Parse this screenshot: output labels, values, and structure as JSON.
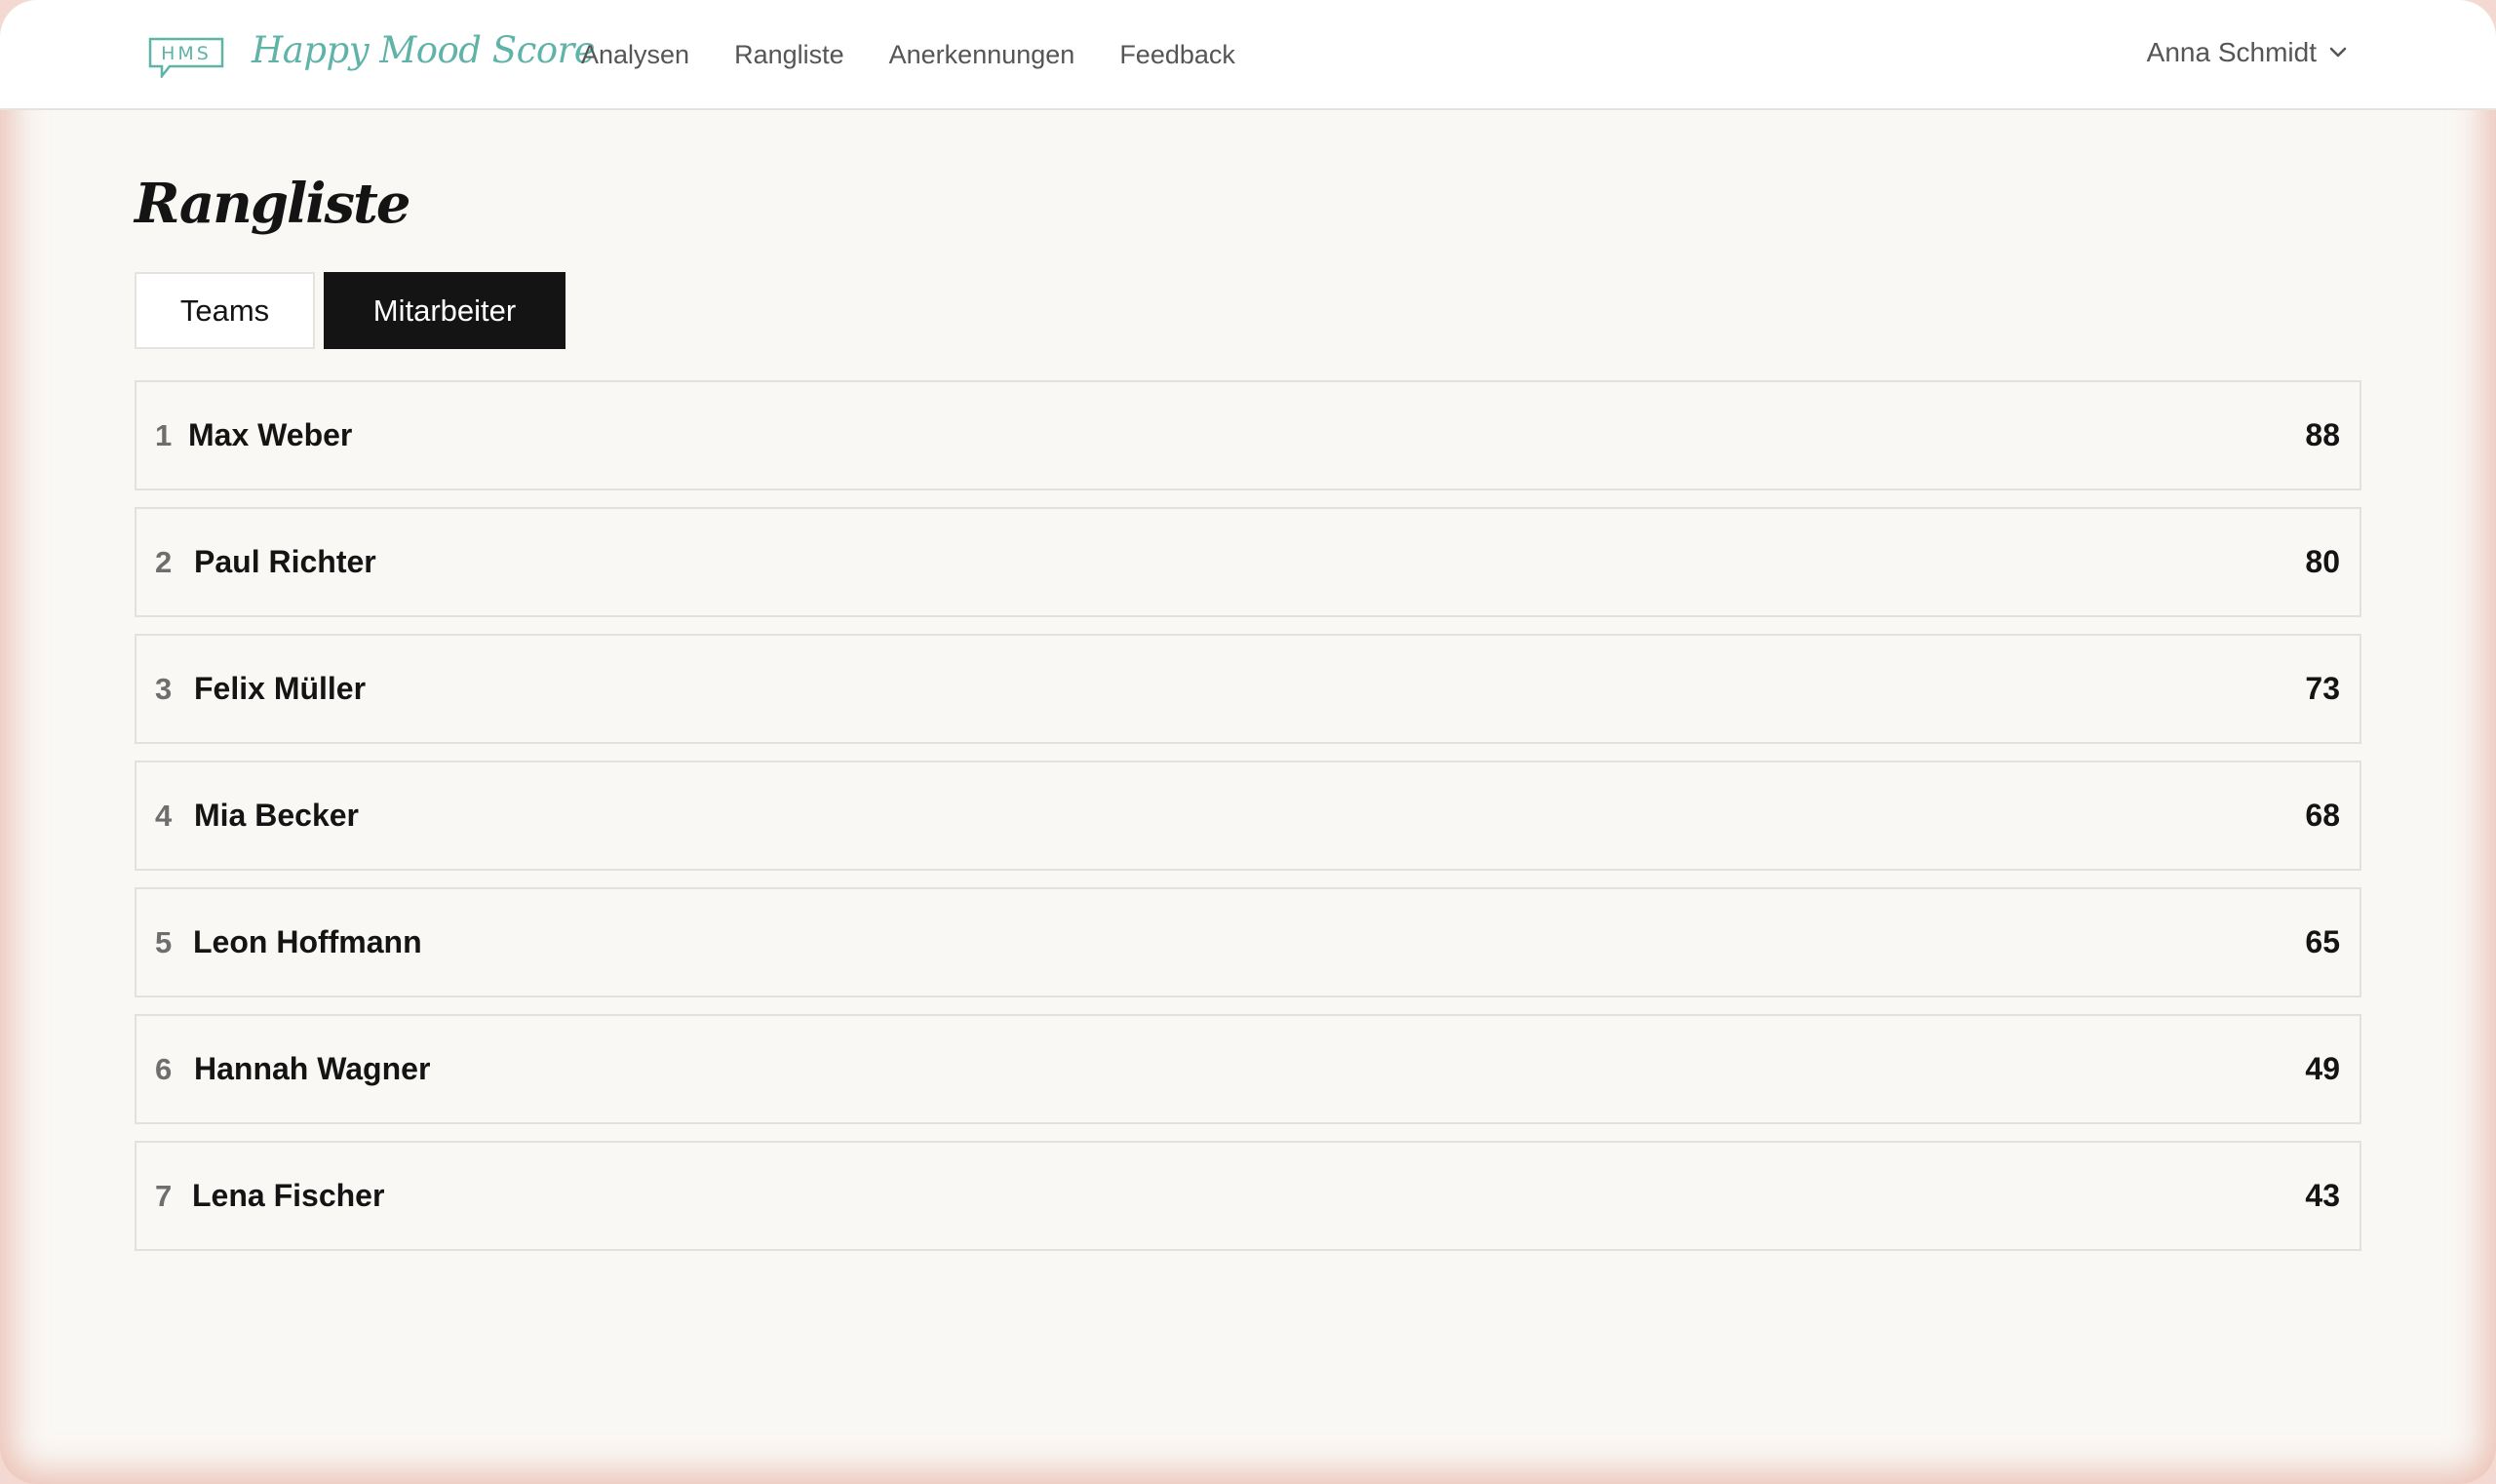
{
  "header": {
    "logo_text": "HMS",
    "brand": "Happy Mood Score",
    "nav": [
      {
        "label": "Analysen"
      },
      {
        "label": "Rangliste"
      },
      {
        "label": "Anerkennungen"
      },
      {
        "label": "Feedback"
      }
    ],
    "user_name": "Anna Schmidt"
  },
  "main": {
    "title": "Rangliste",
    "tabs": [
      {
        "label": "Teams",
        "active": false
      },
      {
        "label": "Mitarbeiter",
        "active": true
      }
    ],
    "ranking": [
      {
        "rank": "1",
        "name": "Max Weber",
        "score": "88"
      },
      {
        "rank": "2",
        "name": "Paul Richter",
        "score": "80"
      },
      {
        "rank": "3",
        "name": "Felix Müller",
        "score": "73"
      },
      {
        "rank": "4",
        "name": "Mia Becker",
        "score": "68"
      },
      {
        "rank": "5",
        "name": "Leon Hoffmann",
        "score": "65"
      },
      {
        "rank": "6",
        "name": "Hannah Wagner",
        "score": "49"
      },
      {
        "rank": "7",
        "name": "Lena Fischer",
        "score": "43"
      }
    ]
  },
  "colors": {
    "brand": "#5fb3a7",
    "active_tab": "#141414",
    "background": "#faf8f5"
  }
}
